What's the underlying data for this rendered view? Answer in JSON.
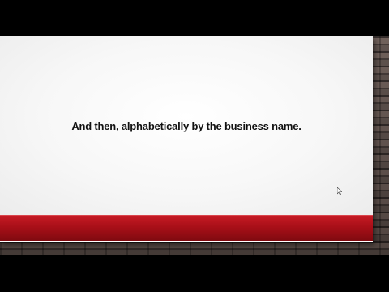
{
  "slide": {
    "text": "And then, alphabetically by the business name."
  },
  "colors": {
    "accent_bar": "#a80f18",
    "slide_background": "#ffffff",
    "text": "#111111",
    "letterbox": "#000000"
  },
  "icons": {
    "cursor": "mouse-pointer-icon"
  }
}
